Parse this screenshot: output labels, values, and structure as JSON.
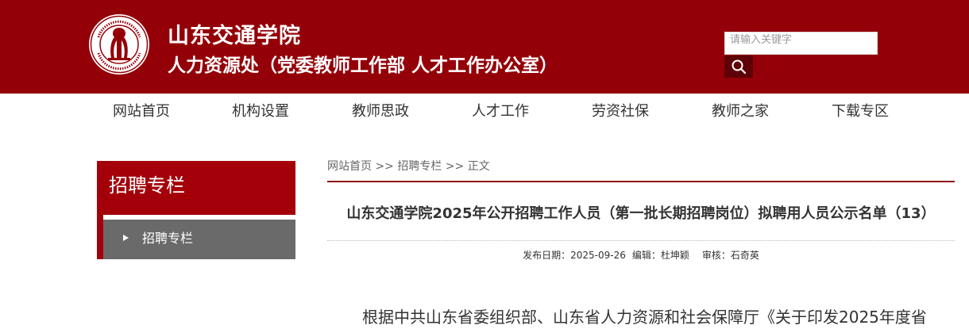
{
  "header": {
    "site_name": "山东交通学院",
    "dept_name": "人力资源处（党委教师工作部 人才工作办公室）",
    "logo_alt": "SHANDONG JIAOTONG UNIVERSITY",
    "bg_color": "#940008"
  },
  "search": {
    "placeholder": "请输入关键字",
    "value": "",
    "button_icon": "search-icon"
  },
  "nav": {
    "items": [
      {
        "label": "网站首页"
      },
      {
        "label": "机构设置"
      },
      {
        "label": "教师思政"
      },
      {
        "label": "人才工作"
      },
      {
        "label": "劳资社保"
      },
      {
        "label": "教师之家"
      },
      {
        "label": "下载专区"
      }
    ]
  },
  "sidebar": {
    "title": "招聘专栏",
    "items": [
      {
        "label": "招聘专栏",
        "icon": "triangle-right-icon"
      }
    ],
    "accent_color": "#a30009"
  },
  "breadcrumb": {
    "items": [
      "网站首页",
      "招聘专栏",
      "正文"
    ],
    "separator": ">>"
  },
  "article": {
    "title": "山东交通学院2025年公开招聘工作人员（第一批长期招聘岗位）拟聘用人员公示名单（13）",
    "meta": {
      "date_label": "发布日期：",
      "date": "2025-09-26",
      "editor_label": "编辑：",
      "editor": "杜坤颖",
      "reviewer_label": "审核：",
      "reviewer": "石奇英"
    },
    "body_first_line": "根据中共山东省委组织部、山东省人力资源和社会保障厅《关于印发2025年度省"
  }
}
